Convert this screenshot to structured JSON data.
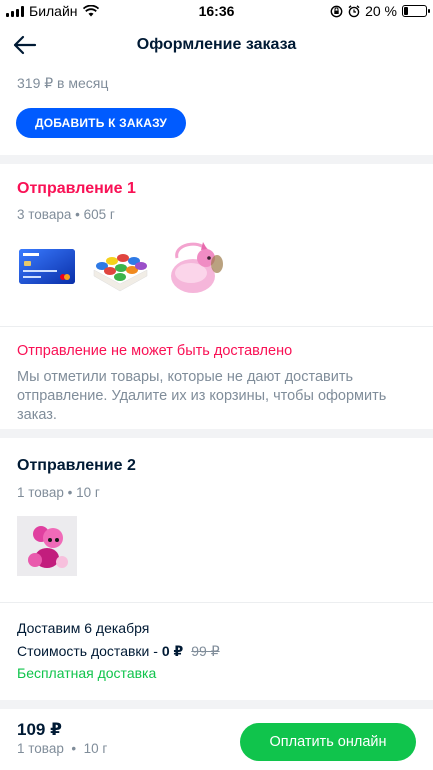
{
  "status_bar": {
    "carrier": "Билайн",
    "time": "16:36",
    "battery": "20 %",
    "battery_level": 0.2
  },
  "header": {
    "title": "Оформление заказа"
  },
  "subscription": {
    "price_text": "319 ₽ в месяц",
    "add_button": "ДОБАВИТЬ К ЗАКАЗУ"
  },
  "shipment1": {
    "title": "Отправление 1",
    "meta": "3 товара • 605 г",
    "items": [
      "ozon-card",
      "play-dough",
      "pink-pony-bag"
    ],
    "warning_title": "Отправление не может быть доставлено",
    "warning_text": "Мы отметили товары, которые не дают доставить отправление. Удалите их из корзины, чтобы оформить заказ."
  },
  "shipment2": {
    "title": "Отправление 2",
    "meta": "1 товар • 10 г",
    "items": [
      "lol-doll"
    ],
    "delivery_date": "Доставим 6 декабря",
    "delivery_cost_label": "Стоимость доставки - ",
    "delivery_cost": "0 ₽",
    "old_price": "99 ₽",
    "free_text": "Бесплатная доставка"
  },
  "footer": {
    "total": "109 ₽",
    "meta": "1 товар  •  10 г",
    "pay_button": "Оплатить онлайн"
  },
  "colors": {
    "accent_blue": "#005bff",
    "error_red": "#f91155",
    "success_green": "#10c44c"
  }
}
